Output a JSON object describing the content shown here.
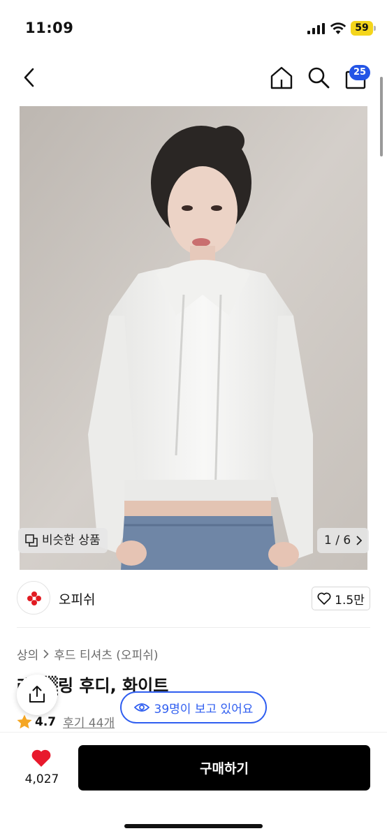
{
  "status_bar": {
    "time": "11:09",
    "battery": "59"
  },
  "nav": {
    "cart_badge": "25"
  },
  "product_image": {
    "similar_label": "비슷한 상품",
    "counter": "1 / 6"
  },
  "brand": {
    "name": "오피쉬",
    "likes": "1.5만"
  },
  "breadcrumb": {
    "category": "상의",
    "subcategory": "후드 티셔츠 (오피쉬)"
  },
  "product": {
    "title_visible": "레▒▒링 후디, 화이트",
    "rating": "4.7",
    "reviews": "후기 44개"
  },
  "viewers": {
    "text": "39명이 보고 있어요"
  },
  "bottom": {
    "wish_count": "4,027",
    "buy_label": "구매하기"
  },
  "colors": {
    "accent_blue": "#2f5ef0",
    "badge_blue": "#2455e6",
    "heart_red": "#e8192c",
    "battery_yellow": "#f4d51c",
    "star": "#f5a623"
  }
}
